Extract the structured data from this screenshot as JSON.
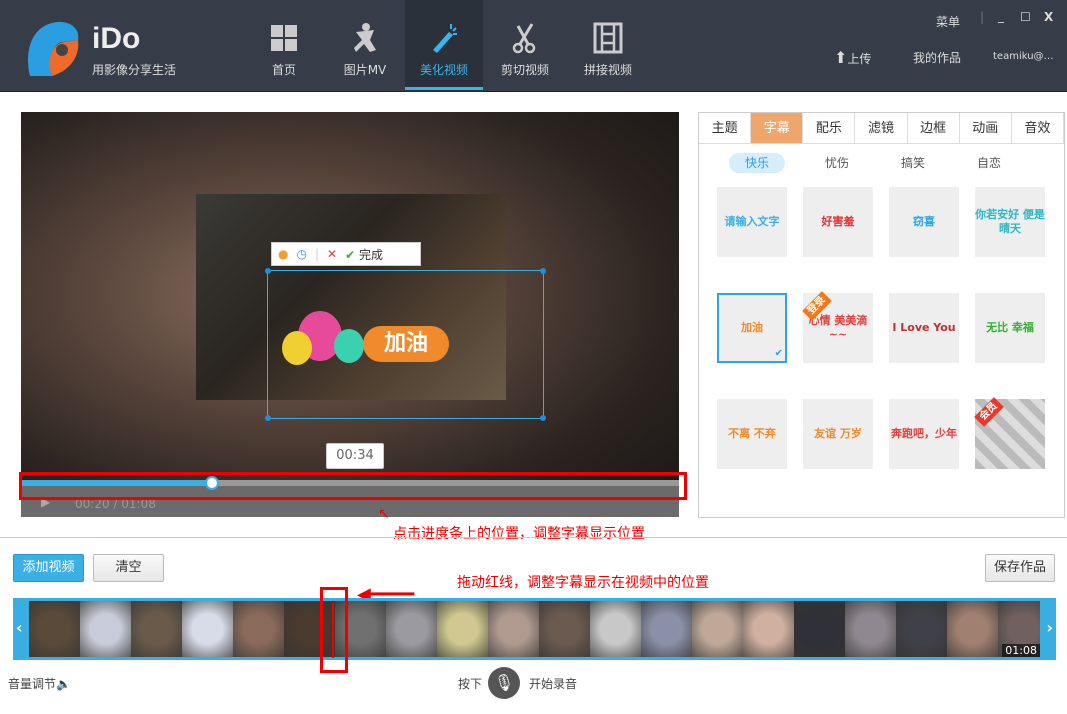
{
  "header": {
    "brand": "iDo",
    "slogan": "用影像分享生活",
    "nav": [
      {
        "label": "首页",
        "icon": "grid-icon"
      },
      {
        "label": "图片MV",
        "icon": "dancer-icon"
      },
      {
        "label": "美化视频",
        "icon": "magic-wand-icon"
      },
      {
        "label": "剪切视频",
        "icon": "scissors-icon"
      },
      {
        "label": "拼接视频",
        "icon": "film-icon"
      }
    ],
    "menu": "菜单",
    "upload": "上传",
    "my_works": "我的作品",
    "user": "teamiku@…"
  },
  "video": {
    "toolbar_done": "完成",
    "tooltip": "00:34",
    "current_time": "00:20",
    "total_time": "01:08",
    "progress": 0.29,
    "caption_text": "加油"
  },
  "annotations": {
    "progress_hint": "点击进度条上的位置，调整字幕显示位置",
    "redline_hint": "拖动红线，调整字幕显示在视频中的位置"
  },
  "panel": {
    "tabs": [
      "主题",
      "字幕",
      "配乐",
      "滤镜",
      "边框",
      "动画",
      "音效"
    ],
    "active_tab": 1,
    "subtabs": [
      "快乐",
      "忧伤",
      "搞笑",
      "自恋"
    ],
    "active_subtab": 0,
    "stickers": [
      {
        "text": "请输入文字",
        "color": "#3ab0e6"
      },
      {
        "text": "好害羞",
        "color": "#e03030"
      },
      {
        "text": "窃喜",
        "color": "#2aa5e8"
      },
      {
        "text": "你若安好 便是晴天",
        "color": "#2ab8c8"
      },
      {
        "text": "加油",
        "color": "#f08a2a"
      },
      {
        "text": "心情 美美滴~~",
        "color": "#e04040",
        "badge": "登录"
      },
      {
        "text": "I Love You",
        "color": "#c03030"
      },
      {
        "text": "无比 幸福",
        "color": "#30b030"
      },
      {
        "text": "不离 不弃",
        "color": "#f08a2a"
      },
      {
        "text": "友谊 万岁",
        "color": "#f08a2a"
      },
      {
        "text": "奔跑吧，少年",
        "color": "#e04040"
      },
      {
        "text": "",
        "color": "#999",
        "badge": "会员"
      }
    ]
  },
  "bottom": {
    "add_video": "添加视频",
    "clear": "清空",
    "save": "保存作品",
    "timeline_end": "01:08",
    "volume": "音量调节",
    "press": "按下",
    "record": "开始录音"
  }
}
